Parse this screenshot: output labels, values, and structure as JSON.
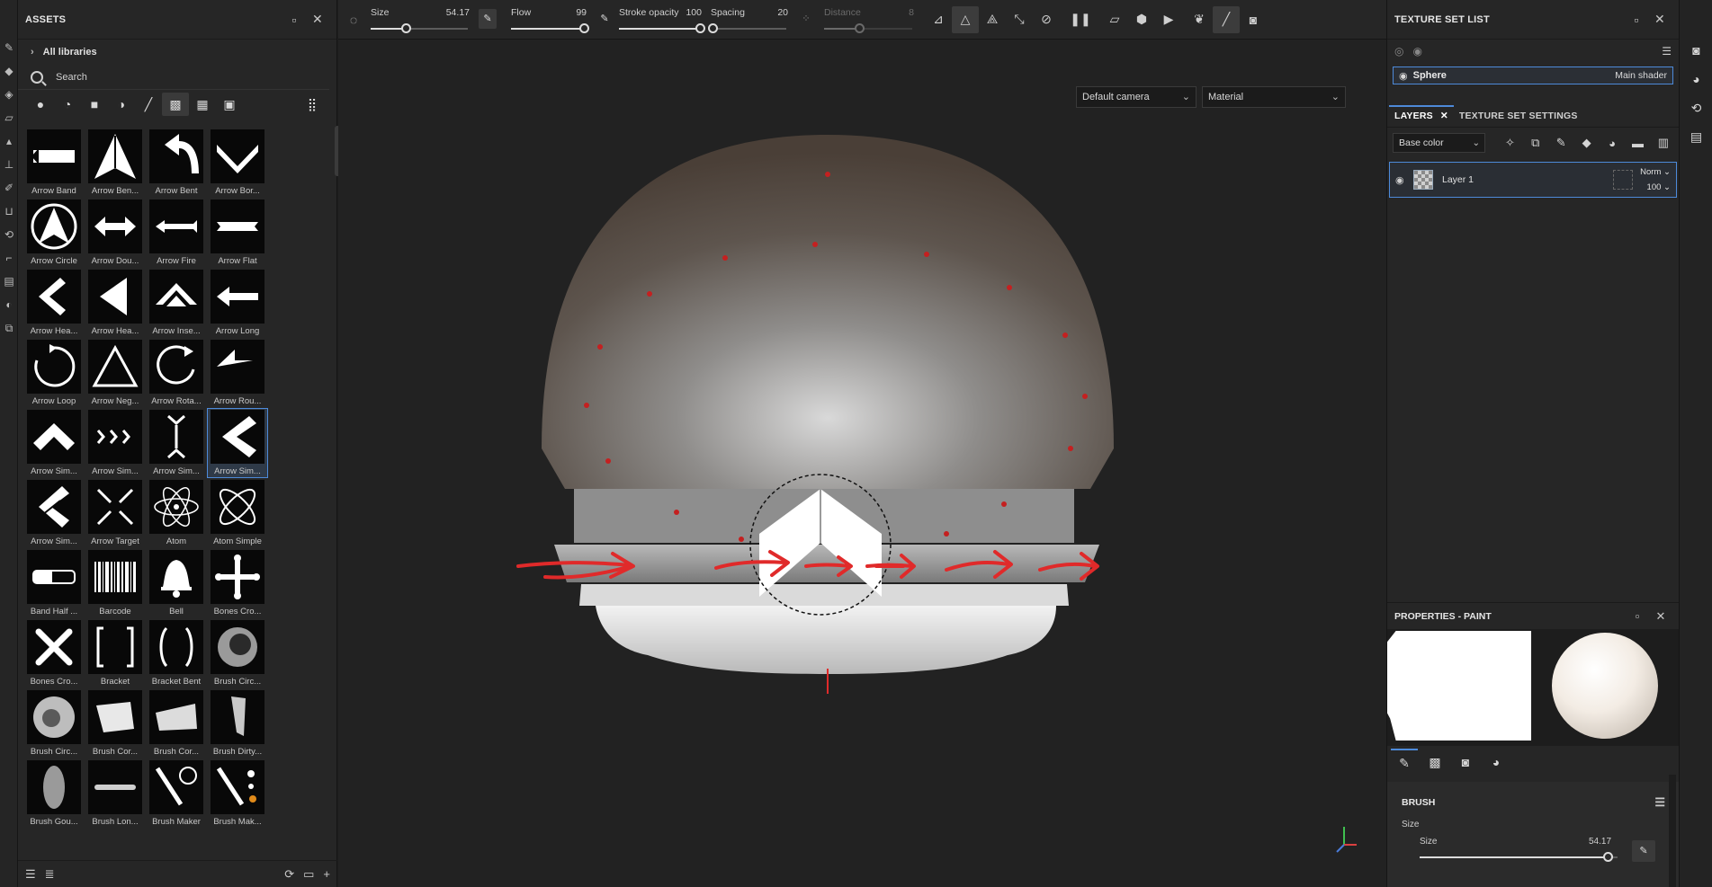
{
  "assets": {
    "title": "ASSETS",
    "libraries_label": "All libraries",
    "search_label": "Search",
    "items": [
      {
        "label": "Arrow Band",
        "icon": "arrow-band-icon"
      },
      {
        "label": "Arrow Ben...",
        "icon": "arrow-bend-icon"
      },
      {
        "label": "Arrow Bent",
        "icon": "arrow-bent-icon"
      },
      {
        "label": "Arrow Bor...",
        "icon": "arrow-border-icon"
      },
      {
        "label": "Arrow Circle",
        "icon": "arrow-circle-icon"
      },
      {
        "label": "Arrow Dou...",
        "icon": "arrow-double-icon"
      },
      {
        "label": "Arrow Fire",
        "icon": "arrow-fire-icon"
      },
      {
        "label": "Arrow Flat",
        "icon": "arrow-flat-icon"
      },
      {
        "label": "Arrow Hea...",
        "icon": "arrow-head-icon"
      },
      {
        "label": "Arrow Hea...",
        "icon": "arrow-head-solid-icon"
      },
      {
        "label": "Arrow Inse...",
        "icon": "arrow-inset-icon"
      },
      {
        "label": "Arrow Long",
        "icon": "arrow-long-icon"
      },
      {
        "label": "Arrow Loop",
        "icon": "arrow-loop-icon"
      },
      {
        "label": "Arrow Neg...",
        "icon": "arrow-negative-icon"
      },
      {
        "label": "Arrow Rota...",
        "icon": "arrow-rotate-icon"
      },
      {
        "label": "Arrow Rou...",
        "icon": "arrow-round-icon"
      },
      {
        "label": "Arrow Sim...",
        "icon": "arrow-simple-icon"
      },
      {
        "label": "Arrow Sim...",
        "icon": "arrow-simple-triple-icon"
      },
      {
        "label": "Arrow Sim...",
        "icon": "arrow-simple-pinch-icon"
      },
      {
        "label": "Arrow Sim...",
        "icon": "arrow-simple-chevron-icon"
      },
      {
        "label": "Arrow Sim...",
        "icon": "arrow-simple-striped-icon"
      },
      {
        "label": "Arrow Target",
        "icon": "arrow-target-icon"
      },
      {
        "label": "Atom",
        "icon": "atom-icon"
      },
      {
        "label": "Atom Simple",
        "icon": "atom-simple-icon"
      },
      {
        "label": "Band Half ...",
        "icon": "band-half-icon"
      },
      {
        "label": "Barcode",
        "icon": "barcode-icon"
      },
      {
        "label": "Bell",
        "icon": "bell-icon"
      },
      {
        "label": "Bones Cro...",
        "icon": "bones-cross-icon"
      },
      {
        "label": "Bones Cro...",
        "icon": "bones-cross-x-icon"
      },
      {
        "label": "Bracket",
        "icon": "bracket-icon"
      },
      {
        "label": "Bracket Bent",
        "icon": "bracket-bent-icon"
      },
      {
        "label": "Brush Circ...",
        "icon": "brush-circle-icon"
      },
      {
        "label": "Brush Circ...",
        "icon": "brush-circle-soft-icon"
      },
      {
        "label": "Brush Cor...",
        "icon": "brush-corner-icon"
      },
      {
        "label": "Brush Cor...",
        "icon": "brush-corner-rough-icon"
      },
      {
        "label": "Brush Dirty...",
        "icon": "brush-dirty-icon"
      },
      {
        "label": "Brush Gou...",
        "icon": "brush-gouache-icon"
      },
      {
        "label": "Brush Lon...",
        "icon": "brush-long-icon"
      },
      {
        "label": "Brush Maker",
        "icon": "brush-maker-icon"
      },
      {
        "label": "Brush Mak...",
        "icon": "brush-maker-alt-icon"
      },
      {
        "label": "",
        "icon": "brush-tools-icon"
      },
      {
        "label": "",
        "icon": "photoshop-brush-icon"
      },
      {
        "label": "",
        "icon": "brush-swirl-icon"
      },
      {
        "label": "",
        "icon": "brush-swirl-alt-icon"
      }
    ],
    "selected_index": 19
  },
  "toolbar": {
    "size": {
      "label": "Size",
      "value": "54.17",
      "fraction": 0.36
    },
    "flow": {
      "label": "Flow",
      "value": "99",
      "fraction": 0.99
    },
    "stroke_opacity": {
      "label": "Stroke opacity",
      "value": "100",
      "fraction": 1.0
    },
    "spacing": {
      "label": "Spacing",
      "value": "20",
      "fraction": 0.02
    },
    "distance": {
      "label": "Distance",
      "value": "8",
      "fraction": 0.4
    }
  },
  "viewport": {
    "camera": "Default camera",
    "shading": "Material"
  },
  "texture_set_list": {
    "title": "TEXTURE SET LIST",
    "item_name": "Sphere",
    "item_shader": "Main shader"
  },
  "layers": {
    "tab_layers": "LAYERS",
    "tab_settings": "TEXTURE SET SETTINGS",
    "channel": "Base color",
    "layer_name": "Layer 1",
    "blend_mode": "Norm",
    "opacity": "100"
  },
  "properties": {
    "title": "PROPERTIES - PAINT",
    "brush_section": "BRUSH",
    "size_caption": "Size",
    "size_label": "Size",
    "size_value": "54.17",
    "size_fraction": 0.95
  },
  "colors": {
    "accent": "#4d8ad9",
    "annotation_red": "#e02a2a",
    "panel_bg": "#262626",
    "viewport_bg": "#222222"
  }
}
